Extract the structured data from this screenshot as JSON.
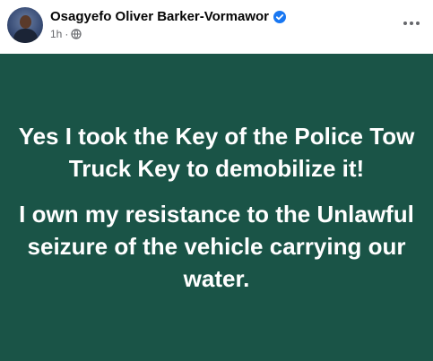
{
  "post": {
    "author": "Osagyefo Oliver Barker-Vormawor",
    "verified": true,
    "timestamp": "1h",
    "separator": "·",
    "audience_icon": "globe-icon",
    "more_icon": "more-horizontal-icon",
    "background_color": "#1a5447",
    "paragraphs": [
      "Yes I took the Key of the Police Tow Truck Key to demobilize it!",
      "I own my resistance to the Unlawful seizure of the vehicle carrying our water."
    ]
  }
}
